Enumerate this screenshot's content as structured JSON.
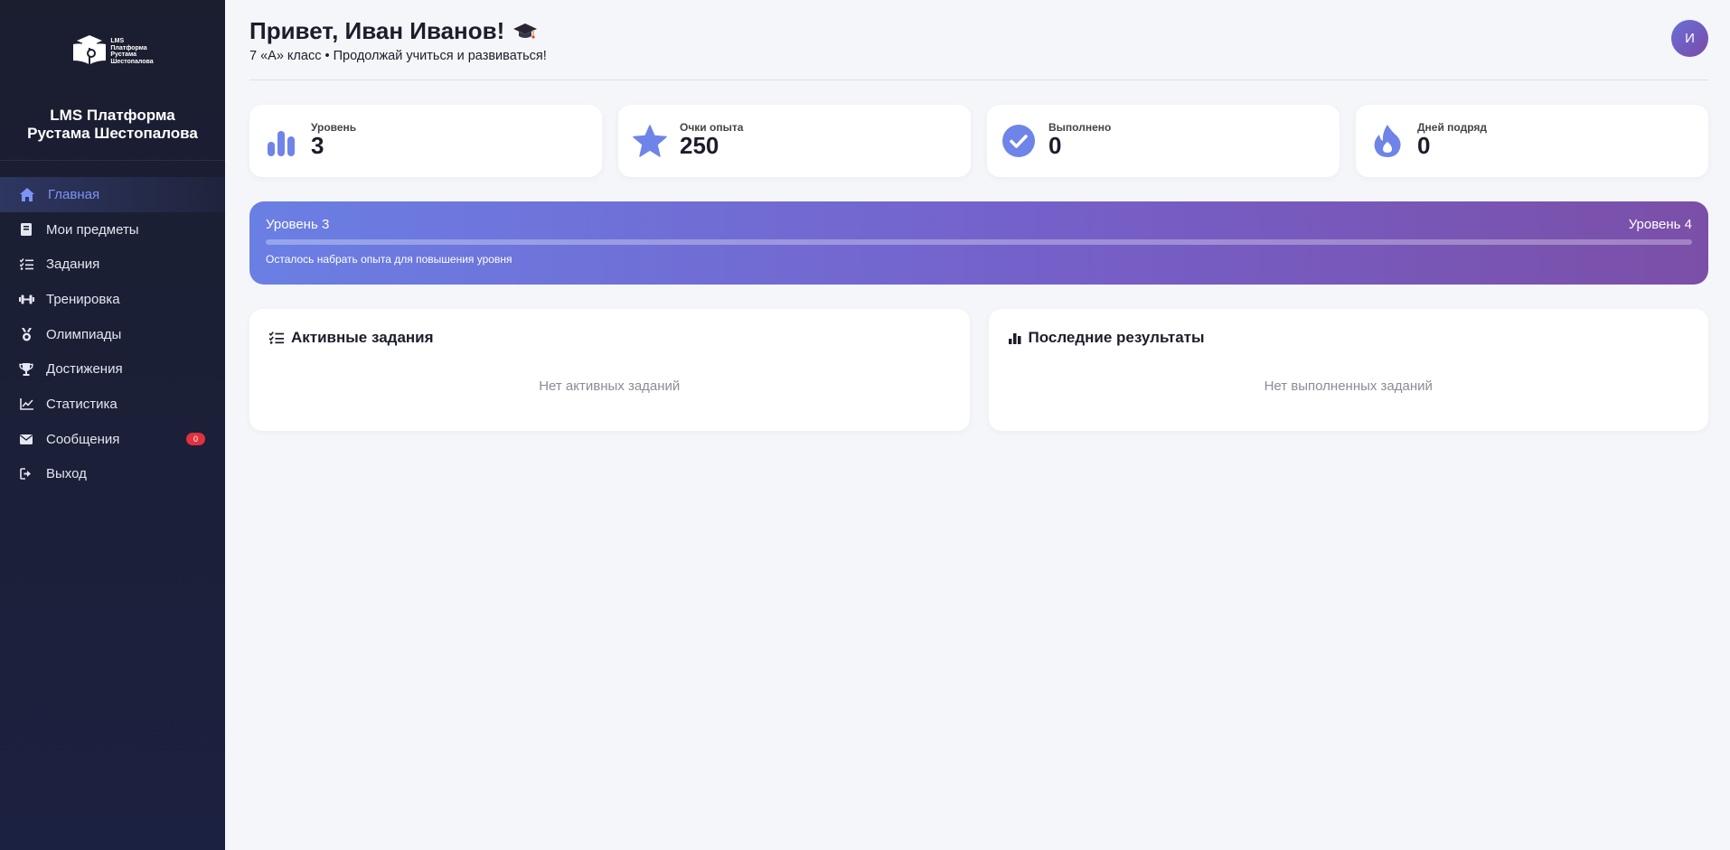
{
  "sidebar": {
    "logo": {
      "line1": "LMS",
      "line2": "Платформа",
      "line3": "Рустама",
      "line4": "Шестопалова"
    },
    "brand_line1": "LMS Платформа",
    "brand_line2": "Рустама Шестопалова",
    "items": [
      {
        "label": "Главная",
        "icon": "home-icon",
        "active": true
      },
      {
        "label": "Мои предметы",
        "icon": "book-icon"
      },
      {
        "label": "Задания",
        "icon": "tasks-icon"
      },
      {
        "label": "Тренировка",
        "icon": "dumbbell-icon"
      },
      {
        "label": "Олимпиады",
        "icon": "medal-icon"
      },
      {
        "label": "Достижения",
        "icon": "trophy-icon"
      },
      {
        "label": "Статистика",
        "icon": "chart-line-icon"
      },
      {
        "label": "Сообщения",
        "icon": "envelope-icon",
        "badge": "0"
      },
      {
        "label": "Выход",
        "icon": "logout-icon"
      }
    ]
  },
  "header": {
    "greeting": "Привет, Иван Иванов!",
    "greeting_icon": "graduation-cap-icon",
    "subtitle": "7 «А» класс • Продолжай учиться и развиваться!",
    "avatar_initial": "И"
  },
  "stats": [
    {
      "label": "Уровень",
      "value": "3",
      "icon": "bar-chart-icon"
    },
    {
      "label": "Очки опыта",
      "value": "250",
      "icon": "star-icon"
    },
    {
      "label": "Выполнено",
      "value": "0",
      "icon": "check-circle-icon"
    },
    {
      "label": "Дней подряд",
      "value": "0",
      "icon": "fire-icon"
    }
  ],
  "level_progress": {
    "current": "Уровень 3",
    "next": "Уровень 4",
    "hint": "Осталось набрать опыта для повышения уровня",
    "fraction": 0.0
  },
  "panels": {
    "active_tasks": {
      "title": "Активные задания",
      "empty": "Нет активных заданий",
      "icon": "tasks-icon"
    },
    "recent_results": {
      "title": "Последние результаты",
      "empty": "Нет выполненных заданий",
      "icon": "bar-chart-icon"
    }
  },
  "colors": {
    "accent": "#667eea",
    "sidebar_bg": "#1b1e2f",
    "badge": "#e0313f",
    "page_bg": "#f4f6fa"
  }
}
